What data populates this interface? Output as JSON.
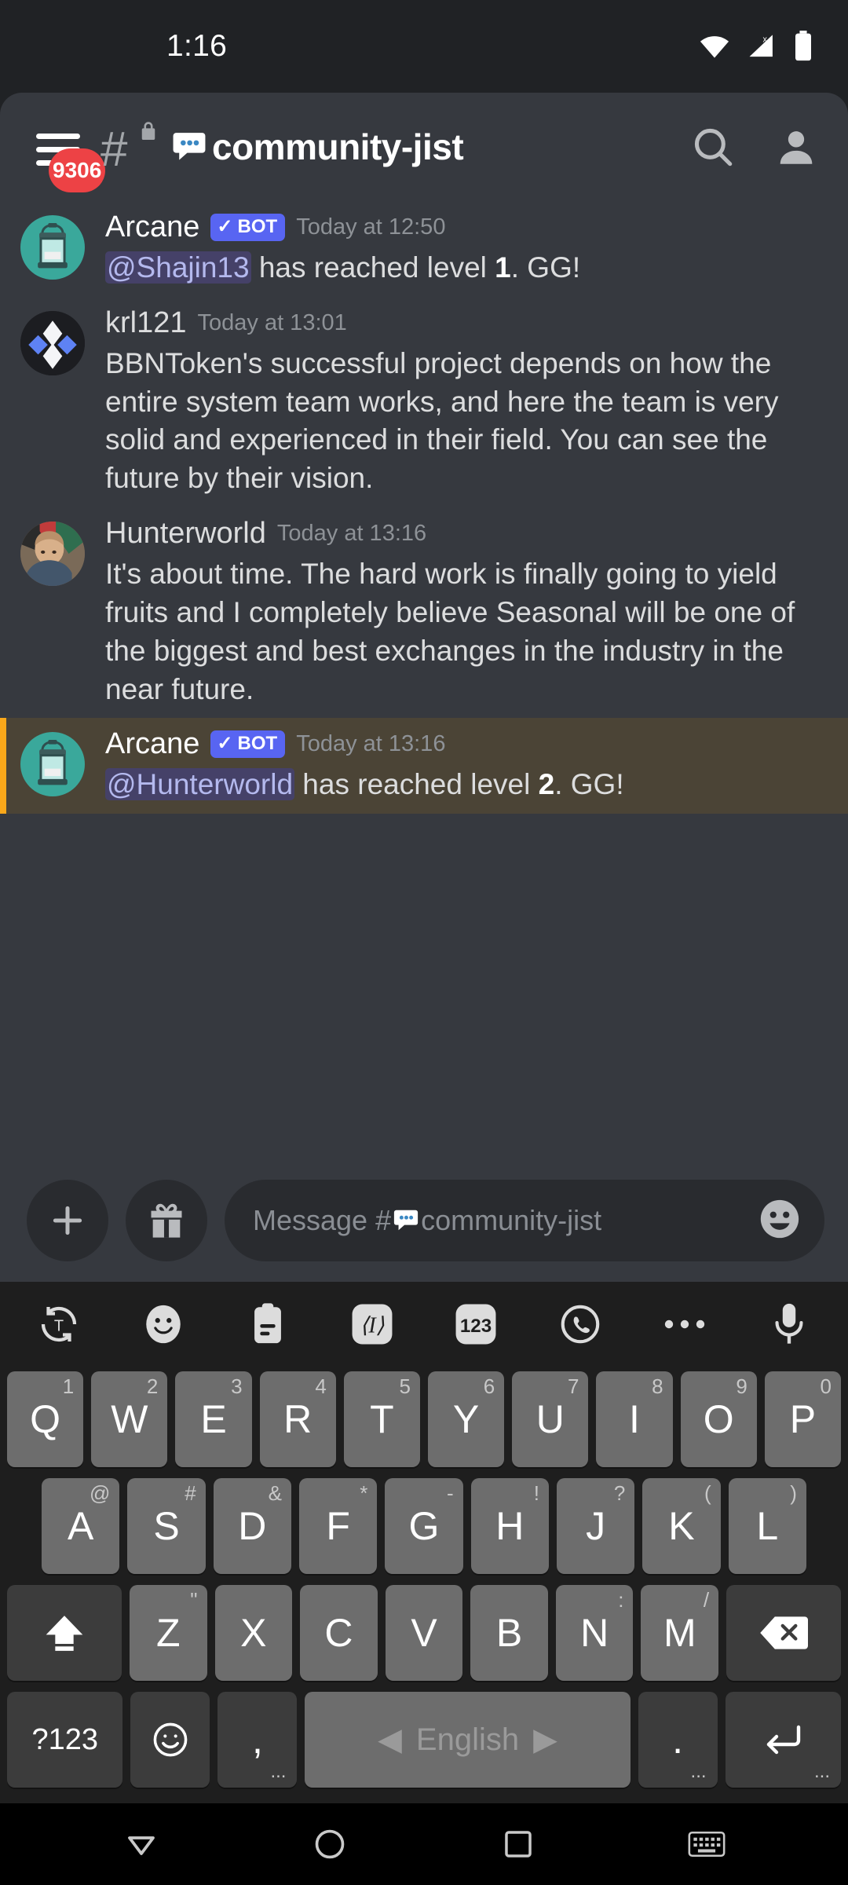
{
  "status_bar": {
    "time": "1:16",
    "icons": [
      "wifi-icon",
      "cellular-signal-icon",
      "battery-icon"
    ]
  },
  "header": {
    "menu_icon": "hamburger-menu-icon",
    "mentions_badge": "9306",
    "channel_hash": "#",
    "lock_icon": "lock-icon",
    "channel_emoji": "speech-balloon-emoji",
    "channel_name": "community-jist",
    "search_icon": "search-icon",
    "members_icon": "members-icon"
  },
  "messages": [
    {
      "author": "Arcane",
      "bot": true,
      "bot_label": "BOT",
      "timestamp": "Today at 12:50",
      "mention": "@Shajin13",
      "text_after": " has reached level ",
      "level": "1",
      "text_end": ". GG!",
      "highlight": false,
      "avatar": "arcane-lantern-avatar"
    },
    {
      "author": "krl121",
      "bot": false,
      "timestamp": "Today at 13:01",
      "text": "BBNToken's  successful project depends on how the entire system team works, and here the team is very solid and experienced in their field. You can see the future by their vision.",
      "highlight": false,
      "avatar": "krl121-diamond-avatar"
    },
    {
      "author": "Hunterworld",
      "bot": false,
      "timestamp": "Today at 13:16",
      "text": "It's about time. The hard work is finally going to yield fruits and I completely believe Seasonal will be one of the biggest and best exchanges in the industry in the near future.",
      "highlight": false,
      "avatar": "hunterworld-photo-avatar"
    },
    {
      "author": "Arcane",
      "bot": true,
      "bot_label": "BOT",
      "timestamp": "Today at 13:16",
      "mention": "@Hunterworld",
      "text_after": " has reached level ",
      "level": "2",
      "text_end": ". GG!",
      "highlight": true,
      "avatar": "arcane-lantern-avatar"
    }
  ],
  "input_bar": {
    "add_icon": "plus-icon",
    "gift_icon": "gift-icon",
    "placeholder_prefix": "Message #",
    "placeholder_emoji": "speech-balloon-emoji",
    "placeholder_channel": "community-jist",
    "emoji_icon": "emoji-face-icon"
  },
  "keyboard": {
    "toolbar": [
      "translate-icon",
      "sticker-smiley-icon",
      "clipboard-icon",
      "text-format-icon",
      "numbers-123-icon",
      "voice-call-icon",
      "more-options-icon",
      "microphone-icon"
    ],
    "toolbar_labels": {
      "numbers": "123",
      "text_format": "⟨I⟩",
      "more": "•••"
    },
    "row1": [
      {
        "key": "Q",
        "hint": "1"
      },
      {
        "key": "W",
        "hint": "2"
      },
      {
        "key": "E",
        "hint": "3"
      },
      {
        "key": "R",
        "hint": "4"
      },
      {
        "key": "T",
        "hint": "5"
      },
      {
        "key": "Y",
        "hint": "6"
      },
      {
        "key": "U",
        "hint": "7"
      },
      {
        "key": "I",
        "hint": "8"
      },
      {
        "key": "O",
        "hint": "9"
      },
      {
        "key": "P",
        "hint": "0"
      }
    ],
    "row2": [
      {
        "key": "A",
        "hint": "@"
      },
      {
        "key": "S",
        "hint": "#"
      },
      {
        "key": "D",
        "hint": "&"
      },
      {
        "key": "F",
        "hint": "*"
      },
      {
        "key": "G",
        "hint": "-"
      },
      {
        "key": "H",
        "hint": "!"
      },
      {
        "key": "J",
        "hint": "?"
      },
      {
        "key": "K",
        "hint": "("
      },
      {
        "key": "L",
        "hint": ")"
      }
    ],
    "row3": [
      {
        "key": "Z",
        "hint": "\""
      },
      {
        "key": "X",
        "hint": ""
      },
      {
        "key": "C",
        "hint": ""
      },
      {
        "key": "V",
        "hint": ""
      },
      {
        "key": "B",
        "hint": ""
      },
      {
        "key": "N",
        "hint": ":"
      },
      {
        "key": "M",
        "hint": "/"
      }
    ],
    "shift_key": "shift-icon",
    "backspace_key": "backspace-icon",
    "symbols_key": "?123",
    "emoji_key": "emoji-key-icon",
    "comma_key": ",",
    "comma_sub": "...",
    "space_key": "English",
    "period_key": ".",
    "period_sub": "...",
    "enter_key": "enter-icon",
    "enter_sub": "..."
  },
  "navbar": {
    "back": "back-triangle-icon",
    "home": "home-circle-icon",
    "recents": "recents-square-icon",
    "keyboard": "keyboard-icon"
  },
  "colors": {
    "discord_bg": "#36393f",
    "header_bg": "#36393f",
    "status_bg": "#202225",
    "blurple": "#5865f2",
    "mention_bg": "#4b4436",
    "mention_bar": "#faa81a",
    "badge_red": "#ed4245",
    "text": "#dcddde",
    "muted": "#8e9297",
    "key_bg": "#6d6d6d",
    "key_dark": "#3c3c3c"
  }
}
